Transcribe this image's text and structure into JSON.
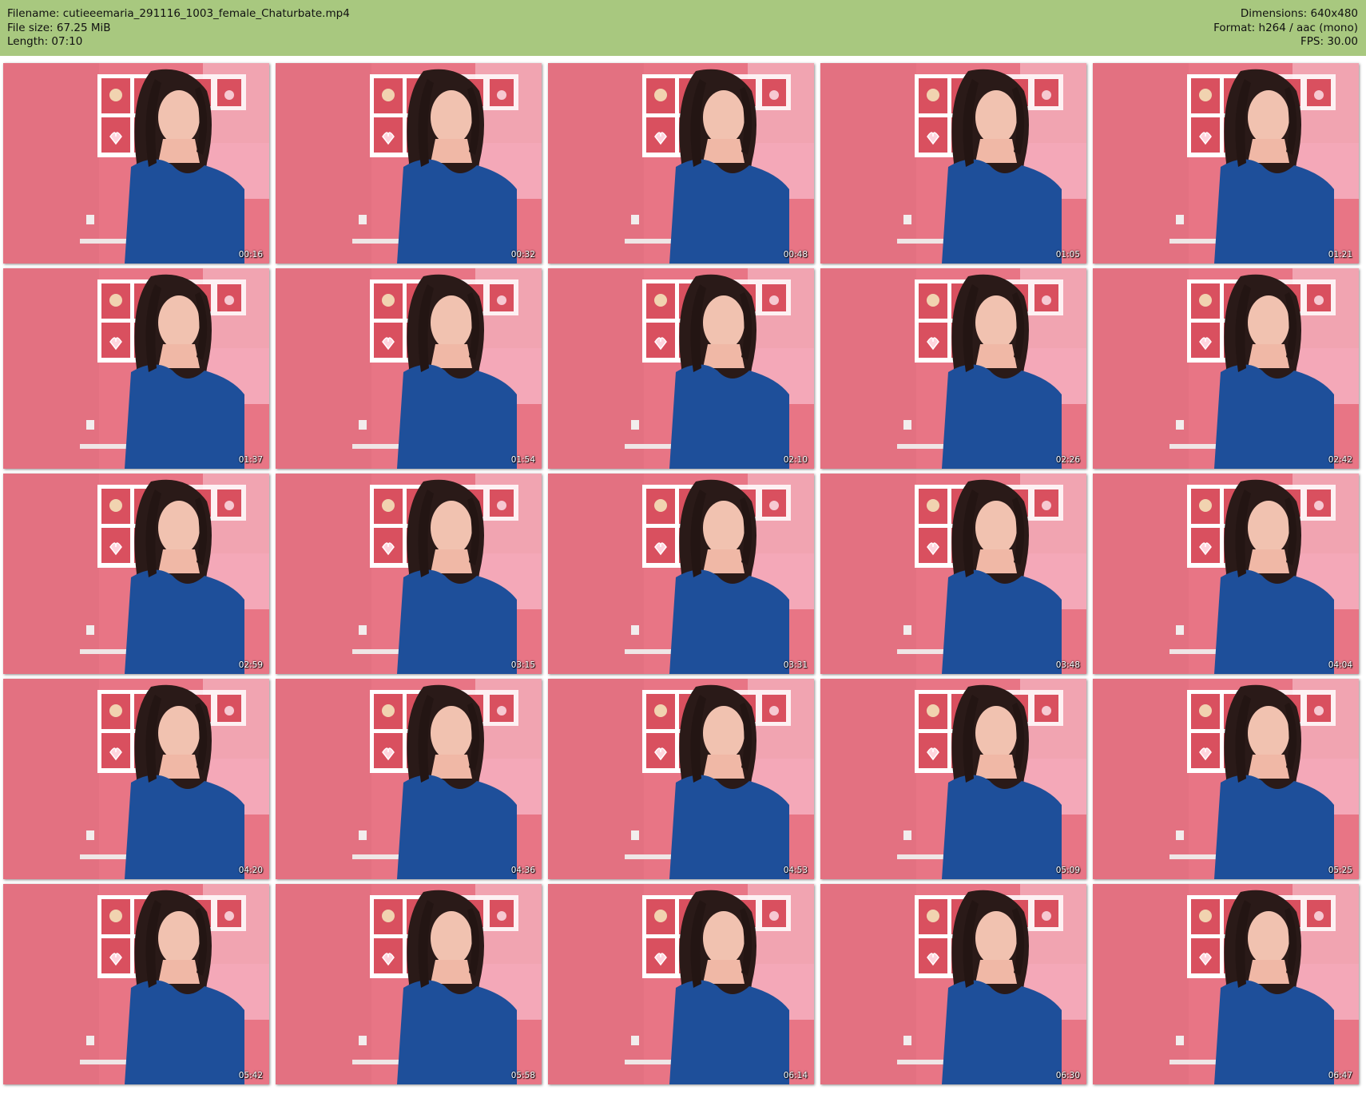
{
  "header": {
    "filename_line": "Filename: cutieeemaria_291116_1003_female_Chaturbate.mp4",
    "filesize_line": "File size: 67.25 MiB",
    "length_line": "Length: 07:10",
    "dimensions_line": "Dimensions: 640x480",
    "format_line": "Format: h264 / aac (mono)",
    "fps_line": "FPS: 30.00"
  },
  "colors": {
    "header_bg": "#a8c87f",
    "wall": "#e87585",
    "shirt": "#1e4f9a",
    "hair": "#2a1a18"
  },
  "thumbnails": [
    {
      "timestamp": "00:16"
    },
    {
      "timestamp": "00:32"
    },
    {
      "timestamp": "00:48"
    },
    {
      "timestamp": "01:05"
    },
    {
      "timestamp": "01:21"
    },
    {
      "timestamp": "01:37"
    },
    {
      "timestamp": "01:54"
    },
    {
      "timestamp": "02:10"
    },
    {
      "timestamp": "02:26"
    },
    {
      "timestamp": "02:42"
    },
    {
      "timestamp": "02:59"
    },
    {
      "timestamp": "03:15"
    },
    {
      "timestamp": "03:31"
    },
    {
      "timestamp": "03:48"
    },
    {
      "timestamp": "04:04"
    },
    {
      "timestamp": "04:20"
    },
    {
      "timestamp": "04:36"
    },
    {
      "timestamp": "04:53"
    },
    {
      "timestamp": "05:09"
    },
    {
      "timestamp": "05:25"
    },
    {
      "timestamp": "05:42"
    },
    {
      "timestamp": "05:58"
    },
    {
      "timestamp": "06:14"
    },
    {
      "timestamp": "06:30"
    },
    {
      "timestamp": "06:47"
    }
  ]
}
